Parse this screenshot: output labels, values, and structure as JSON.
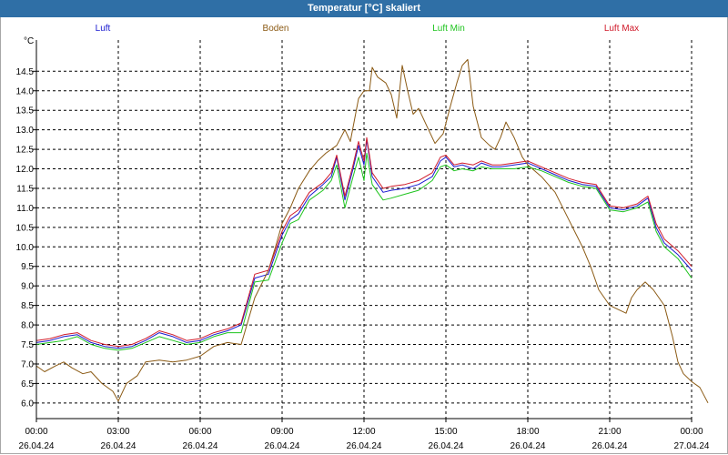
{
  "window": {
    "title": "Temperatur [°C] skaliert"
  },
  "colors": {
    "titlebar": "#2f6fa6",
    "luft": "#1a1ad0",
    "boden": "#8b5a14",
    "luft_min": "#1ec41e",
    "luft_max": "#d01a2a",
    "grid": "#000000"
  },
  "chart_data": {
    "type": "line",
    "title": "Temperatur [°C] skaliert",
    "ylabel": "°C",
    "ylim": [
      5.6,
      15.3
    ],
    "xlim": [
      0,
      24
    ],
    "grid": true,
    "legend_position": "top",
    "y_ticks": [
      6.0,
      6.5,
      7.0,
      7.5,
      8.0,
      8.5,
      9.0,
      9.5,
      10.0,
      10.5,
      11.0,
      11.5,
      12.0,
      12.5,
      13.0,
      13.5,
      14.0,
      14.5
    ],
    "x_ticks": [
      {
        "time": "00:00",
        "date": "26.04.24"
      },
      {
        "time": "03:00",
        "date": "26.04.24"
      },
      {
        "time": "06:00",
        "date": "26.04.24"
      },
      {
        "time": "09:00",
        "date": "26.04.24"
      },
      {
        "time": "12:00",
        "date": "26.04.24"
      },
      {
        "time": "15:00",
        "date": "26.04.24"
      },
      {
        "time": "18:00",
        "date": "26.04.24"
      },
      {
        "time": "21:00",
        "date": "26.04.24"
      },
      {
        "time": "00:00",
        "date": "27.04.24"
      }
    ],
    "series": [
      {
        "name": "Luft",
        "color": "#1a1ad0",
        "points": [
          [
            0.0,
            7.55
          ],
          [
            0.5,
            7.6
          ],
          [
            1.0,
            7.7
          ],
          [
            1.5,
            7.75
          ],
          [
            2.0,
            7.55
          ],
          [
            2.5,
            7.45
          ],
          [
            3.0,
            7.4
          ],
          [
            3.5,
            7.45
          ],
          [
            4.0,
            7.6
          ],
          [
            4.5,
            7.8
          ],
          [
            5.0,
            7.7
          ],
          [
            5.5,
            7.55
          ],
          [
            6.0,
            7.6
          ],
          [
            6.5,
            7.75
          ],
          [
            7.0,
            7.85
          ],
          [
            7.5,
            8.0
          ],
          [
            8.0,
            9.2
          ],
          [
            8.5,
            9.3
          ],
          [
            9.0,
            10.3
          ],
          [
            9.3,
            10.7
          ],
          [
            9.6,
            10.85
          ],
          [
            10.0,
            11.3
          ],
          [
            10.5,
            11.6
          ],
          [
            10.8,
            11.8
          ],
          [
            11.0,
            12.3
          ],
          [
            11.3,
            11.2
          ],
          [
            11.6,
            12.0
          ],
          [
            11.8,
            12.6
          ],
          [
            12.0,
            12.1
          ],
          [
            12.1,
            12.75
          ],
          [
            12.3,
            11.8
          ],
          [
            12.7,
            11.4
          ],
          [
            13.0,
            11.45
          ],
          [
            13.5,
            11.5
          ],
          [
            14.0,
            11.6
          ],
          [
            14.5,
            11.8
          ],
          [
            14.8,
            12.2
          ],
          [
            15.0,
            12.3
          ],
          [
            15.3,
            12.05
          ],
          [
            15.6,
            12.1
          ],
          [
            16.0,
            12.0
          ],
          [
            16.3,
            12.15
          ],
          [
            16.7,
            12.05
          ],
          [
            17.0,
            12.05
          ],
          [
            17.5,
            12.1
          ],
          [
            18.0,
            12.15
          ],
          [
            18.5,
            12.0
          ],
          [
            19.0,
            11.85
          ],
          [
            19.5,
            11.7
          ],
          [
            20.0,
            11.6
          ],
          [
            20.5,
            11.55
          ],
          [
            21.0,
            11.0
          ],
          [
            21.5,
            10.95
          ],
          [
            22.0,
            11.05
          ],
          [
            22.4,
            11.25
          ],
          [
            22.7,
            10.5
          ],
          [
            23.0,
            10.1
          ],
          [
            23.5,
            9.8
          ],
          [
            24.0,
            9.4
          ]
        ]
      },
      {
        "name": "Boden",
        "color": "#8b5a14",
        "points": [
          [
            0.0,
            6.95
          ],
          [
            0.3,
            6.8
          ],
          [
            0.7,
            6.95
          ],
          [
            1.0,
            7.05
          ],
          [
            1.3,
            6.9
          ],
          [
            1.7,
            6.75
          ],
          [
            2.0,
            6.8
          ],
          [
            2.4,
            6.5
          ],
          [
            2.8,
            6.3
          ],
          [
            3.0,
            6.05
          ],
          [
            3.3,
            6.5
          ],
          [
            3.7,
            6.7
          ],
          [
            4.0,
            7.05
          ],
          [
            4.5,
            7.1
          ],
          [
            5.0,
            7.05
          ],
          [
            5.5,
            7.1
          ],
          [
            6.0,
            7.2
          ],
          [
            6.5,
            7.45
          ],
          [
            7.0,
            7.55
          ],
          [
            7.5,
            7.5
          ],
          [
            8.0,
            8.7
          ],
          [
            8.5,
            9.4
          ],
          [
            8.8,
            10.1
          ],
          [
            9.0,
            10.6
          ],
          [
            9.3,
            11.0
          ],
          [
            9.6,
            11.5
          ],
          [
            10.0,
            11.95
          ],
          [
            10.3,
            12.2
          ],
          [
            10.6,
            12.4
          ],
          [
            11.0,
            12.6
          ],
          [
            11.3,
            13.0
          ],
          [
            11.5,
            12.7
          ],
          [
            11.8,
            13.8
          ],
          [
            12.0,
            14.0
          ],
          [
            12.2,
            14.0
          ],
          [
            12.3,
            14.6
          ],
          [
            12.5,
            14.35
          ],
          [
            12.8,
            14.2
          ],
          [
            13.0,
            13.9
          ],
          [
            13.2,
            13.3
          ],
          [
            13.4,
            14.65
          ],
          [
            13.6,
            14.0
          ],
          [
            13.8,
            13.4
          ],
          [
            14.0,
            13.55
          ],
          [
            14.3,
            13.1
          ],
          [
            14.6,
            12.65
          ],
          [
            14.9,
            12.9
          ],
          [
            15.2,
            13.7
          ],
          [
            15.4,
            14.2
          ],
          [
            15.6,
            14.65
          ],
          [
            15.8,
            14.8
          ],
          [
            16.0,
            13.6
          ],
          [
            16.3,
            12.8
          ],
          [
            16.6,
            12.6
          ],
          [
            16.8,
            12.5
          ],
          [
            17.0,
            12.8
          ],
          [
            17.2,
            13.2
          ],
          [
            17.5,
            12.8
          ],
          [
            17.8,
            12.3
          ],
          [
            18.0,
            12.1
          ],
          [
            18.5,
            11.8
          ],
          [
            19.0,
            11.4
          ],
          [
            19.5,
            10.7
          ],
          [
            20.0,
            10.0
          ],
          [
            20.3,
            9.5
          ],
          [
            20.6,
            8.9
          ],
          [
            21.0,
            8.5
          ],
          [
            21.3,
            8.4
          ],
          [
            21.6,
            8.3
          ],
          [
            21.8,
            8.7
          ],
          [
            22.0,
            8.9
          ],
          [
            22.3,
            9.1
          ],
          [
            22.6,
            8.9
          ],
          [
            23.0,
            8.5
          ],
          [
            23.3,
            7.7
          ],
          [
            23.5,
            7.05
          ],
          [
            23.7,
            6.75
          ],
          [
            24.0,
            6.55
          ],
          [
            24.3,
            6.4
          ],
          [
            24.6,
            6.0
          ]
        ]
      },
      {
        "name": "Luft Min",
        "color": "#1ec41e",
        "points": [
          [
            0.0,
            7.5
          ],
          [
            0.5,
            7.55
          ],
          [
            1.0,
            7.6
          ],
          [
            1.5,
            7.7
          ],
          [
            2.0,
            7.5
          ],
          [
            2.5,
            7.4
          ],
          [
            3.0,
            7.35
          ],
          [
            3.5,
            7.4
          ],
          [
            4.0,
            7.55
          ],
          [
            4.5,
            7.7
          ],
          [
            5.0,
            7.6
          ],
          [
            5.5,
            7.5
          ],
          [
            6.0,
            7.55
          ],
          [
            6.5,
            7.7
          ],
          [
            7.0,
            7.8
          ],
          [
            7.5,
            7.8
          ],
          [
            8.0,
            9.1
          ],
          [
            8.5,
            9.15
          ],
          [
            9.0,
            10.1
          ],
          [
            9.3,
            10.6
          ],
          [
            9.6,
            10.7
          ],
          [
            10.0,
            11.2
          ],
          [
            10.5,
            11.45
          ],
          [
            10.8,
            11.7
          ],
          [
            11.0,
            12.1
          ],
          [
            11.3,
            11.0
          ],
          [
            11.6,
            11.8
          ],
          [
            11.8,
            12.3
          ],
          [
            12.0,
            11.7
          ],
          [
            12.1,
            12.4
          ],
          [
            12.3,
            11.6
          ],
          [
            12.7,
            11.2
          ],
          [
            13.0,
            11.25
          ],
          [
            13.5,
            11.35
          ],
          [
            14.0,
            11.45
          ],
          [
            14.5,
            11.7
          ],
          [
            14.8,
            12.05
          ],
          [
            15.0,
            12.1
          ],
          [
            15.3,
            11.95
          ],
          [
            15.6,
            12.0
          ],
          [
            16.0,
            11.95
          ],
          [
            16.3,
            12.05
          ],
          [
            16.7,
            12.0
          ],
          [
            17.0,
            12.0
          ],
          [
            17.5,
            12.0
          ],
          [
            18.0,
            12.05
          ],
          [
            18.5,
            11.95
          ],
          [
            19.0,
            11.8
          ],
          [
            19.5,
            11.65
          ],
          [
            20.0,
            11.55
          ],
          [
            20.5,
            11.5
          ],
          [
            21.0,
            10.95
          ],
          [
            21.5,
            10.9
          ],
          [
            22.0,
            11.0
          ],
          [
            22.4,
            11.15
          ],
          [
            22.7,
            10.4
          ],
          [
            23.0,
            10.0
          ],
          [
            23.5,
            9.7
          ],
          [
            24.0,
            9.2
          ]
        ]
      },
      {
        "name": "Luft Max",
        "color": "#d01a2a",
        "points": [
          [
            0.0,
            7.6
          ],
          [
            0.5,
            7.65
          ],
          [
            1.0,
            7.75
          ],
          [
            1.5,
            7.8
          ],
          [
            2.0,
            7.6
          ],
          [
            2.5,
            7.5
          ],
          [
            3.0,
            7.45
          ],
          [
            3.5,
            7.5
          ],
          [
            4.0,
            7.65
          ],
          [
            4.5,
            7.85
          ],
          [
            5.0,
            7.75
          ],
          [
            5.5,
            7.6
          ],
          [
            6.0,
            7.65
          ],
          [
            6.5,
            7.8
          ],
          [
            7.0,
            7.9
          ],
          [
            7.5,
            8.05
          ],
          [
            8.0,
            9.3
          ],
          [
            8.5,
            9.4
          ],
          [
            9.0,
            10.4
          ],
          [
            9.3,
            10.8
          ],
          [
            9.6,
            10.95
          ],
          [
            10.0,
            11.4
          ],
          [
            10.5,
            11.65
          ],
          [
            10.8,
            11.9
          ],
          [
            11.0,
            12.35
          ],
          [
            11.3,
            11.3
          ],
          [
            11.6,
            12.1
          ],
          [
            11.8,
            12.7
          ],
          [
            12.0,
            12.2
          ],
          [
            12.1,
            12.8
          ],
          [
            12.3,
            11.9
          ],
          [
            12.7,
            11.5
          ],
          [
            13.0,
            11.55
          ],
          [
            13.5,
            11.6
          ],
          [
            14.0,
            11.7
          ],
          [
            14.5,
            11.9
          ],
          [
            14.8,
            12.3
          ],
          [
            15.0,
            12.35
          ],
          [
            15.3,
            12.1
          ],
          [
            15.6,
            12.15
          ],
          [
            16.0,
            12.1
          ],
          [
            16.3,
            12.2
          ],
          [
            16.7,
            12.1
          ],
          [
            17.0,
            12.1
          ],
          [
            17.5,
            12.15
          ],
          [
            18.0,
            12.2
          ],
          [
            18.5,
            12.05
          ],
          [
            19.0,
            11.9
          ],
          [
            19.5,
            11.75
          ],
          [
            20.0,
            11.65
          ],
          [
            20.5,
            11.6
          ],
          [
            21.0,
            11.05
          ],
          [
            21.5,
            11.0
          ],
          [
            22.0,
            11.1
          ],
          [
            22.4,
            11.3
          ],
          [
            22.7,
            10.6
          ],
          [
            23.0,
            10.2
          ],
          [
            23.5,
            9.9
          ],
          [
            24.0,
            9.5
          ]
        ]
      }
    ]
  }
}
